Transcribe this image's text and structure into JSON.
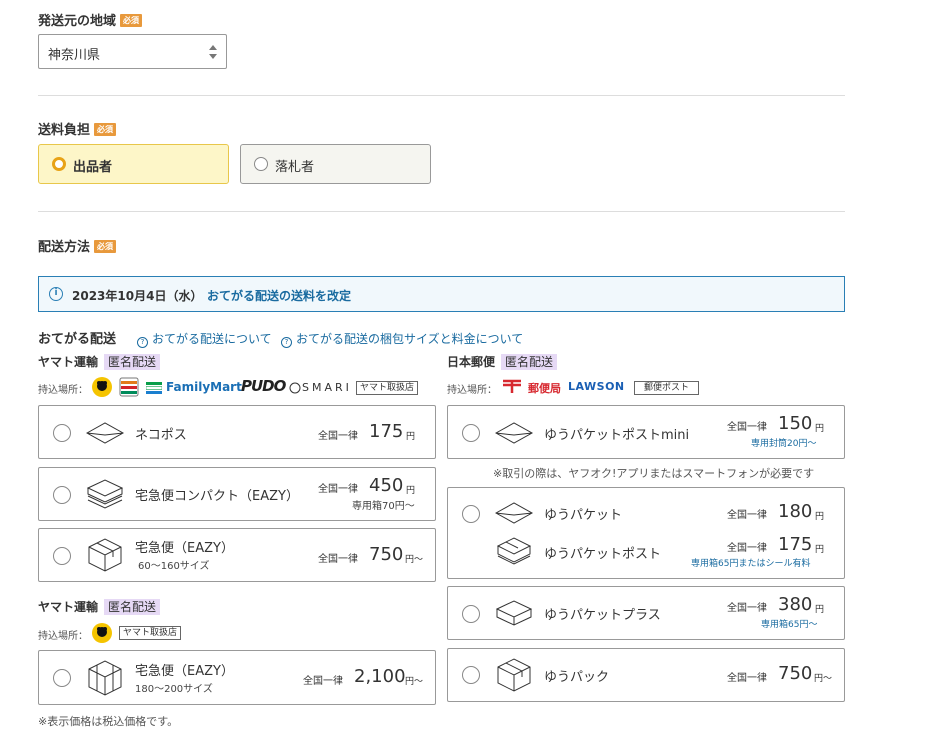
{
  "region": {
    "title": "発送元の地域",
    "required": "必須",
    "value": "神奈川県"
  },
  "payer": {
    "title": "送料負担",
    "required": "必須",
    "options": [
      "出品者",
      "落札者"
    ],
    "selected": 0
  },
  "method": {
    "title": "配送方法",
    "required": "必須"
  },
  "notice": {
    "date": "2023年10月4日（水）",
    "link": "おてがる配送の送料を改定"
  },
  "otegaru": {
    "title": "おてがる配送",
    "link1": "おてがる配送について",
    "link2": "おてがる配送の梱包サイズと料金について"
  },
  "yamato": {
    "name": "ヤマト運輸",
    "anon": "匿名配送",
    "drop_label": "持込場所：",
    "drop_brands": [
      "FamilyMart",
      "PUDO",
      "SMARI"
    ],
    "drop_tag": "ヤマト取扱店",
    "services": [
      {
        "name": "ネコポス",
        "zenkoku": "全国一律",
        "price": "175",
        "unit": "円",
        "note": ""
      },
      {
        "name": "宅急便コンパクト（EAZY）",
        "zenkoku": "全国一律",
        "price": "450",
        "unit": "円",
        "note": "専用箱70円〜"
      },
      {
        "name": "宅急便（EAZY）",
        "sub": "60〜160サイズ",
        "zenkoku": "全国一律",
        "price": "750",
        "unit": "円〜"
      }
    ]
  },
  "yamato2": {
    "name": "ヤマト運輸",
    "anon": "匿名配送",
    "drop_label": "持込場所：",
    "drop_tag": "ヤマト取扱店",
    "service": {
      "name": "宅急便（EAZY）",
      "sub": "180〜200サイズ",
      "zenkoku": "全国一律",
      "price": "2,100",
      "unit": "円〜"
    }
  },
  "japanpost": {
    "name": "日本郵便",
    "anon": "匿名配送",
    "drop_label": "持込場所：",
    "drop_brands": [
      "郵便局",
      "LAWSON"
    ],
    "drop_tag": "郵便ポスト",
    "note_app": "※取引の際は、ヤフオク!アプリまたはスマートフォンが必要です",
    "services": [
      {
        "name": "ゆうパケットポストmini",
        "zenkoku": "全国一律",
        "price": "150",
        "unit": "円",
        "note": "専用封筒20円〜"
      },
      {
        "name": "ゆうパケット",
        "zenkoku": "全国一律",
        "price": "180",
        "unit": "円"
      },
      {
        "name": "ゆうパケットポスト",
        "zenkoku": "全国一律",
        "price": "175",
        "unit": "円",
        "note": "専用箱65円またはシール有料"
      },
      {
        "name": "ゆうパケットプラス",
        "zenkoku": "全国一律",
        "price": "380",
        "unit": "円",
        "note": "専用箱65円〜"
      },
      {
        "name": "ゆうパック",
        "zenkoku": "全国一律",
        "price": "750",
        "unit": "円〜"
      }
    ]
  },
  "footer": "※表示価格は税込価格です。",
  "colors": {
    "accent": "#e8993c",
    "link": "#1a6ba0",
    "selected_bg": "#fdf6c8",
    "anon_bg": "#e6d9f5"
  }
}
